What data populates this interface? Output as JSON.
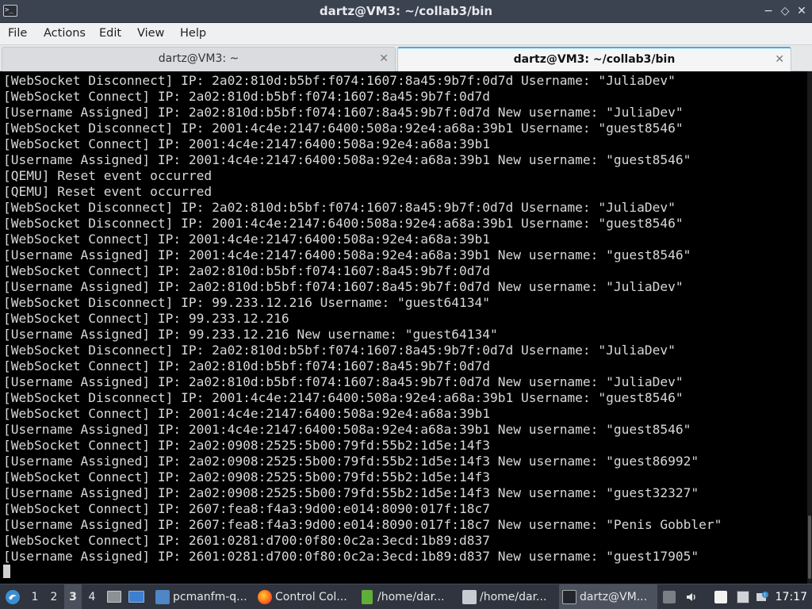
{
  "window": {
    "title": "dartz@VM3: ~/collab3/bin",
    "app_icon_glyph": ">_",
    "controls": {
      "minimize": "−",
      "maximize": "◇",
      "close": "✕"
    }
  },
  "menu": [
    "File",
    "Actions",
    "Edit",
    "View",
    "Help"
  ],
  "tabs": [
    {
      "label": "dartz@VM3: ~",
      "close": "✕",
      "active": false
    },
    {
      "label": "dartz@VM3: ~/collab3/bin",
      "close": "✕",
      "active": true
    }
  ],
  "terminal_lines": [
    "[WebSocket Disconnect] IP: 2a02:810d:b5bf:f074:1607:8a45:9b7f:0d7d Username: \"JuliaDev\"",
    "[WebSocket Connect] IP: 2a02:810d:b5bf:f074:1607:8a45:9b7f:0d7d",
    "[Username Assigned] IP: 2a02:810d:b5bf:f074:1607:8a45:9b7f:0d7d New username: \"JuliaDev\"",
    "[WebSocket Disconnect] IP: 2001:4c4e:2147:6400:508a:92e4:a68a:39b1 Username: \"guest8546\"",
    "[WebSocket Connect] IP: 2001:4c4e:2147:6400:508a:92e4:a68a:39b1",
    "[Username Assigned] IP: 2001:4c4e:2147:6400:508a:92e4:a68a:39b1 New username: \"guest8546\"",
    "[QEMU] Reset event occurred",
    "[QEMU] Reset event occurred",
    "[WebSocket Disconnect] IP: 2a02:810d:b5bf:f074:1607:8a45:9b7f:0d7d Username: \"JuliaDev\"",
    "[WebSocket Disconnect] IP: 2001:4c4e:2147:6400:508a:92e4:a68a:39b1 Username: \"guest8546\"",
    "[WebSocket Connect] IP: 2001:4c4e:2147:6400:508a:92e4:a68a:39b1",
    "[Username Assigned] IP: 2001:4c4e:2147:6400:508a:92e4:a68a:39b1 New username: \"guest8546\"",
    "[WebSocket Connect] IP: 2a02:810d:b5bf:f074:1607:8a45:9b7f:0d7d",
    "[Username Assigned] IP: 2a02:810d:b5bf:f074:1607:8a45:9b7f:0d7d New username: \"JuliaDev\"",
    "[WebSocket Disconnect] IP: 99.233.12.216 Username: \"guest64134\"",
    "[WebSocket Connect] IP: 99.233.12.216",
    "[Username Assigned] IP: 99.233.12.216 New username: \"guest64134\"",
    "[WebSocket Disconnect] IP: 2a02:810d:b5bf:f074:1607:8a45:9b7f:0d7d Username: \"JuliaDev\"",
    "[WebSocket Connect] IP: 2a02:810d:b5bf:f074:1607:8a45:9b7f:0d7d",
    "[Username Assigned] IP: 2a02:810d:b5bf:f074:1607:8a45:9b7f:0d7d New username: \"JuliaDev\"",
    "[WebSocket Disconnect] IP: 2001:4c4e:2147:6400:508a:92e4:a68a:39b1 Username: \"guest8546\"",
    "[WebSocket Connect] IP: 2001:4c4e:2147:6400:508a:92e4:a68a:39b1",
    "[Username Assigned] IP: 2001:4c4e:2147:6400:508a:92e4:a68a:39b1 New username: \"guest8546\"",
    "[WebSocket Connect] IP: 2a02:0908:2525:5b00:79fd:55b2:1d5e:14f3",
    "[Username Assigned] IP: 2a02:0908:2525:5b00:79fd:55b2:1d5e:14f3 New username: \"guest86992\"",
    "[WebSocket Connect] IP: 2a02:0908:2525:5b00:79fd:55b2:1d5e:14f3",
    "[Username Assigned] IP: 2a02:0908:2525:5b00:79fd:55b2:1d5e:14f3 New username: \"guest32327\"",
    "[WebSocket Connect] IP: 2607:fea8:f4a3:9d00:e014:8090:017f:18c7",
    "[Username Assigned] IP: 2607:fea8:f4a3:9d00:e014:8090:017f:18c7 New username: \"Penis Gobbler\"",
    "[WebSocket Connect] IP: 2601:0281:d700:0f80:0c2a:3ecd:1b89:d837",
    "[Username Assigned] IP: 2601:0281:d700:0f80:0c2a:3ecd:1b89:d837 New username: \"guest17905\""
  ],
  "taskbar": {
    "desktops": [
      "1",
      "2",
      "3",
      "4"
    ],
    "active_desktop": "3",
    "tasks": [
      {
        "label": "pcmanfm-q...",
        "icon": "folder-icon"
      },
      {
        "label": "Control Col...",
        "icon": "firefox-icon"
      },
      {
        "label": "/home/dar...",
        "icon": "text-editor-icon"
      },
      {
        "label": "/home/dar...",
        "icon": "feather-icon"
      },
      {
        "label": "dartz@VM...",
        "icon": "terminal-icon",
        "active": true
      }
    ],
    "clock": "17:17"
  },
  "colors": {
    "titlebar": "#3b4250",
    "terminal_bg": "#000000",
    "terminal_fg": "#d8d8d8",
    "taskbar": "#2f343f",
    "tab_accent": "#3daee9"
  }
}
